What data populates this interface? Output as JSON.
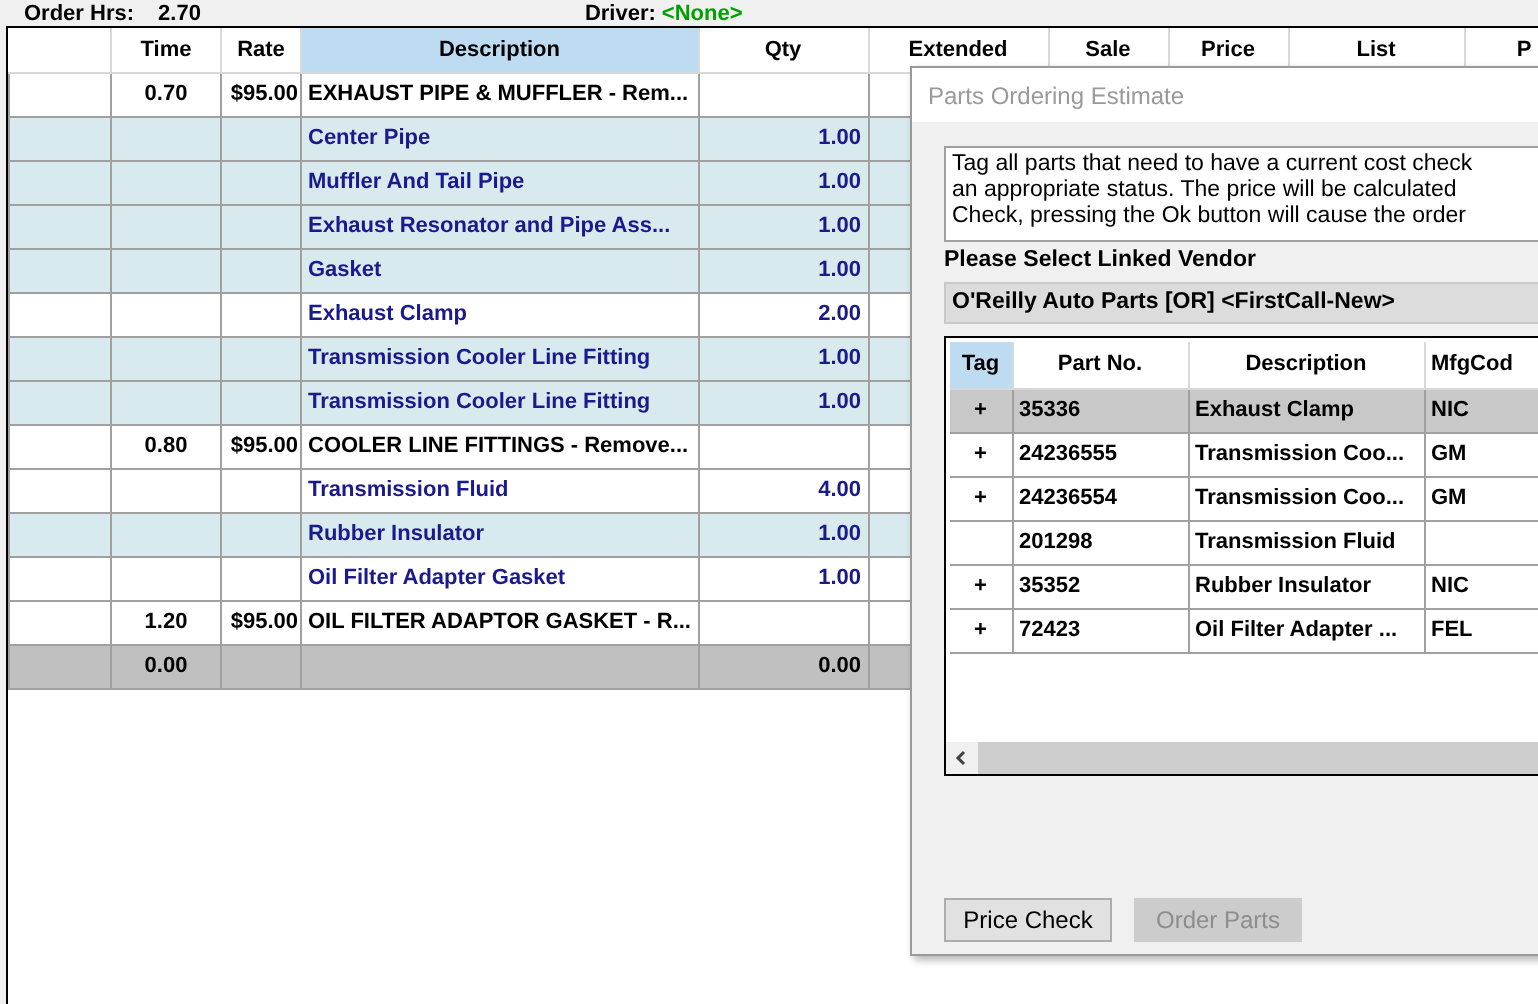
{
  "header": {
    "order_hrs_label": "Order Hrs:",
    "order_hrs_value": "2.70",
    "driver_label": "Driver:",
    "driver_value": "<None>"
  },
  "table": {
    "columns": [
      {
        "selected": false
      },
      {
        "label": "Time",
        "selected": false
      },
      {
        "label": "Rate",
        "selected": false
      },
      {
        "label": "Description",
        "selected": true
      },
      {
        "label": "Qty",
        "selected": false
      },
      {
        "label": "Extended",
        "selected": false
      },
      {
        "label": "Sale",
        "selected": false
      },
      {
        "label": "Price",
        "selected": false
      },
      {
        "label": "List",
        "selected": false
      },
      {
        "label": "P",
        "selected": false
      }
    ],
    "rows": [
      {
        "kind": "labor",
        "highlighted": false,
        "time": "0.70",
        "rate": "$95.00",
        "description": "EXHAUST PIPE & MUFFLER - Rem...",
        "qty": ""
      },
      {
        "kind": "part",
        "highlighted": true,
        "time": "",
        "rate": "",
        "description": "Center Pipe",
        "qty": "1.00"
      },
      {
        "kind": "part",
        "highlighted": true,
        "time": "",
        "rate": "",
        "description": "Muffler And Tail Pipe",
        "qty": "1.00"
      },
      {
        "kind": "part",
        "highlighted": true,
        "time": "",
        "rate": "",
        "description": "Exhaust Resonator and Pipe Ass...",
        "qty": "1.00"
      },
      {
        "kind": "part",
        "highlighted": true,
        "time": "",
        "rate": "",
        "description": "Gasket",
        "qty": "1.00"
      },
      {
        "kind": "part",
        "highlighted": false,
        "time": "",
        "rate": "",
        "description": "Exhaust Clamp",
        "qty": "2.00"
      },
      {
        "kind": "part",
        "highlighted": true,
        "time": "",
        "rate": "",
        "description": "Transmission Cooler Line Fitting",
        "qty": "1.00"
      },
      {
        "kind": "part",
        "highlighted": true,
        "time": "",
        "rate": "",
        "description": "Transmission Cooler Line Fitting",
        "qty": "1.00"
      },
      {
        "kind": "labor",
        "highlighted": false,
        "time": "0.80",
        "rate": "$95.00",
        "description": "COOLER LINE FITTINGS - Remove...",
        "qty": ""
      },
      {
        "kind": "part",
        "highlighted": false,
        "time": "",
        "rate": "",
        "description": "Transmission Fluid",
        "qty": "4.00"
      },
      {
        "kind": "part",
        "highlighted": true,
        "time": "",
        "rate": "",
        "description": "Rubber Insulator",
        "qty": "1.00"
      },
      {
        "kind": "part",
        "highlighted": false,
        "time": "",
        "rate": "",
        "description": "Oil Filter Adapter Gasket",
        "qty": "1.00"
      },
      {
        "kind": "labor",
        "highlighted": false,
        "time": "1.20",
        "rate": "$95.00",
        "description": "OIL FILTER ADAPTOR GASKET - R...",
        "qty": ""
      },
      {
        "kind": "total",
        "time": "0.00",
        "rate": "",
        "description": "",
        "qty": "0.00"
      }
    ]
  },
  "dialog": {
    "title": "Parts Ordering Estimate",
    "instructions": [
      "Tag all parts that need to have a current cost check",
      "an appropriate status.  The price will be calculated",
      "Check, pressing the Ok button will cause the order"
    ],
    "vendor_label": "Please Select Linked Vendor",
    "vendor": "O'Reilly Auto Parts [OR] <FirstCall-New>",
    "columns": [
      {
        "label": "Tag",
        "selected": true
      },
      {
        "label": "Part No.",
        "selected": false
      },
      {
        "label": "Description",
        "selected": false
      },
      {
        "label": "MfgCod",
        "selected": false
      }
    ],
    "rows": [
      {
        "tag": "+",
        "part_no": "35336",
        "description": "Exhaust Clamp",
        "mfg": "NIC",
        "selected": true
      },
      {
        "tag": "+",
        "part_no": "24236555",
        "description": "Transmission Coo...",
        "mfg": "GM",
        "selected": false
      },
      {
        "tag": "+",
        "part_no": "24236554",
        "description": "Transmission Coo...",
        "mfg": "GM",
        "selected": false
      },
      {
        "tag": "",
        "part_no": "201298",
        "description": "Transmission Fluid",
        "mfg": "",
        "selected": false
      },
      {
        "tag": "+",
        "part_no": "35352",
        "description": "Rubber Insulator",
        "mfg": "NIC",
        "selected": false
      },
      {
        "tag": "+",
        "part_no": "72423",
        "description": "Oil Filter Adapter ...",
        "mfg": "FEL",
        "selected": false
      }
    ],
    "buttons": [
      {
        "label": "Price Check",
        "disabled": false
      },
      {
        "label": "Order Parts",
        "disabled": true
      }
    ]
  }
}
